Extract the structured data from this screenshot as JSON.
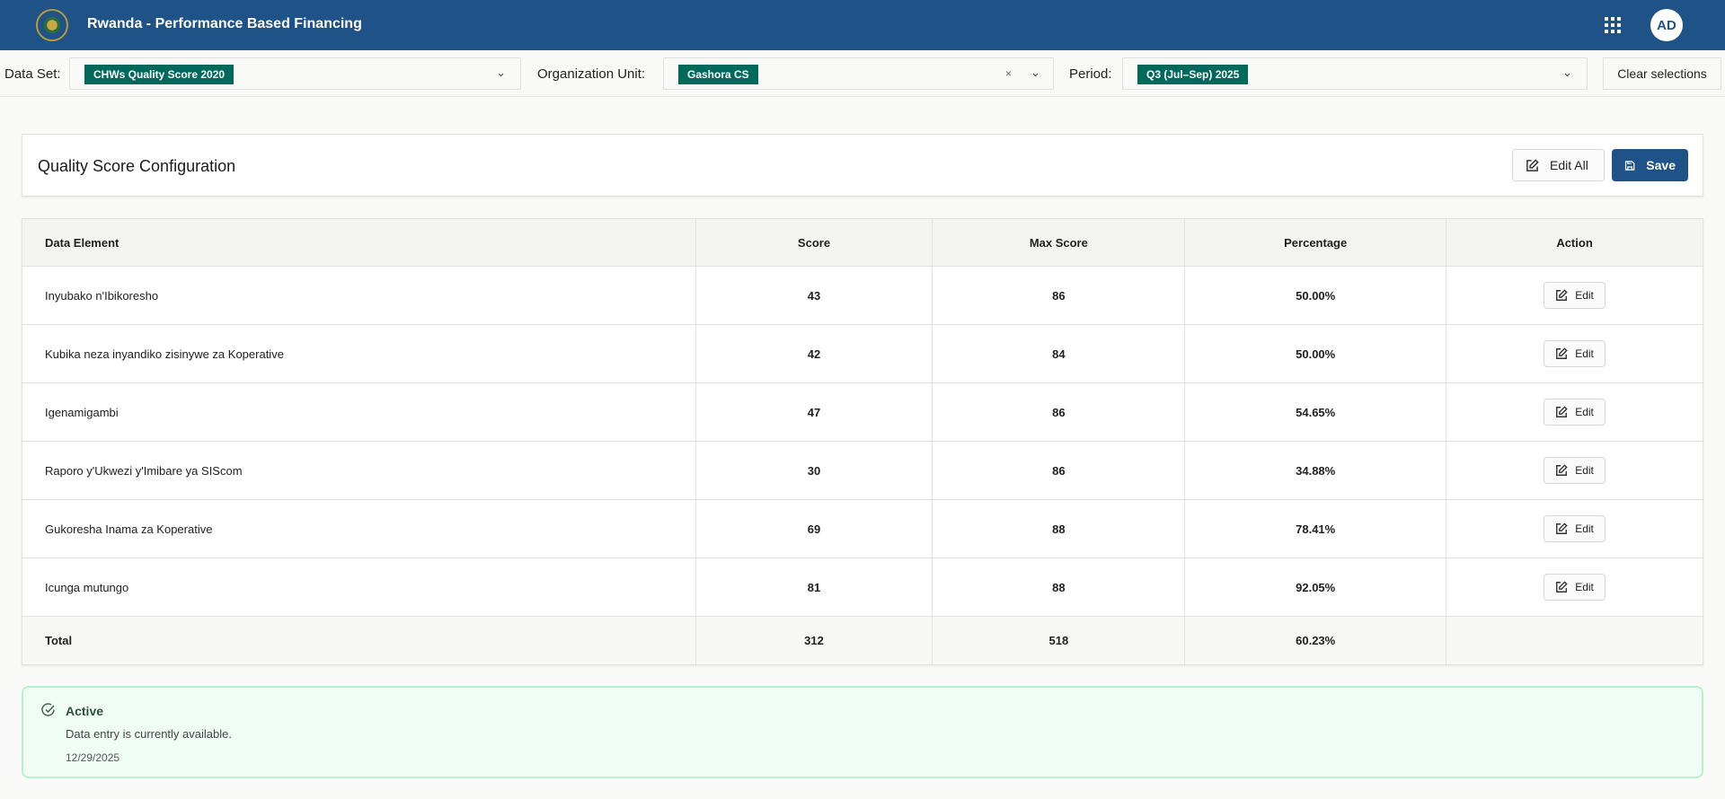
{
  "header": {
    "title": "Rwanda - Performance Based Financing",
    "avatar": "AD",
    "icons": [
      "rwanda-emblem-logo",
      "apps-grid-icon"
    ]
  },
  "filters": {
    "dataset": {
      "label": "Data Set:",
      "value": "CHWs Quality Score 2020"
    },
    "org_unit": {
      "label": "Organization Unit:",
      "value": "Gashora CS",
      "clear": "×"
    },
    "period": {
      "label": "Period:",
      "value": "Q3 (Jul–Sep) 2025"
    },
    "clear_label": "Clear selections"
  },
  "card": {
    "title": "Quality Score Configuration",
    "edit_all": "Edit All",
    "save": "Save"
  },
  "table": {
    "headers": [
      "Data Element",
      "Score",
      "Max Score",
      "Percentage",
      "Action"
    ],
    "rows": [
      {
        "element": "Inyubako n'Ibikoresho",
        "score": "43",
        "max": "86",
        "pct": "50.00%",
        "action": "Edit"
      },
      {
        "element": "Kubika neza inyandiko zisinywe za Koperative",
        "score": "42",
        "max": "84",
        "pct": "50.00%",
        "action": "Edit"
      },
      {
        "element": "Igenamigambi",
        "score": "47",
        "max": "86",
        "pct": "54.65%",
        "action": "Edit"
      },
      {
        "element": "Raporo y'Ukwezi y'Imibare ya SIScom",
        "score": "30",
        "max": "86",
        "pct": "34.88%",
        "action": "Edit"
      },
      {
        "element": "Gukoresha Inama za Koperative",
        "score": "69",
        "max": "88",
        "pct": "78.41%",
        "action": "Edit"
      },
      {
        "element": "Icunga mutungo",
        "score": "81",
        "max": "88",
        "pct": "92.05%",
        "action": "Edit"
      }
    ],
    "total": {
      "label": "Total",
      "score": "312",
      "max": "518",
      "pct": "60.23%"
    }
  },
  "status": {
    "title": "Active",
    "message": "Data entry is currently available.",
    "date": "12/29/2025"
  },
  "colors": {
    "primary": "#1f5286",
    "chip": "#00695c",
    "status_bg": "#f0fdf4"
  }
}
